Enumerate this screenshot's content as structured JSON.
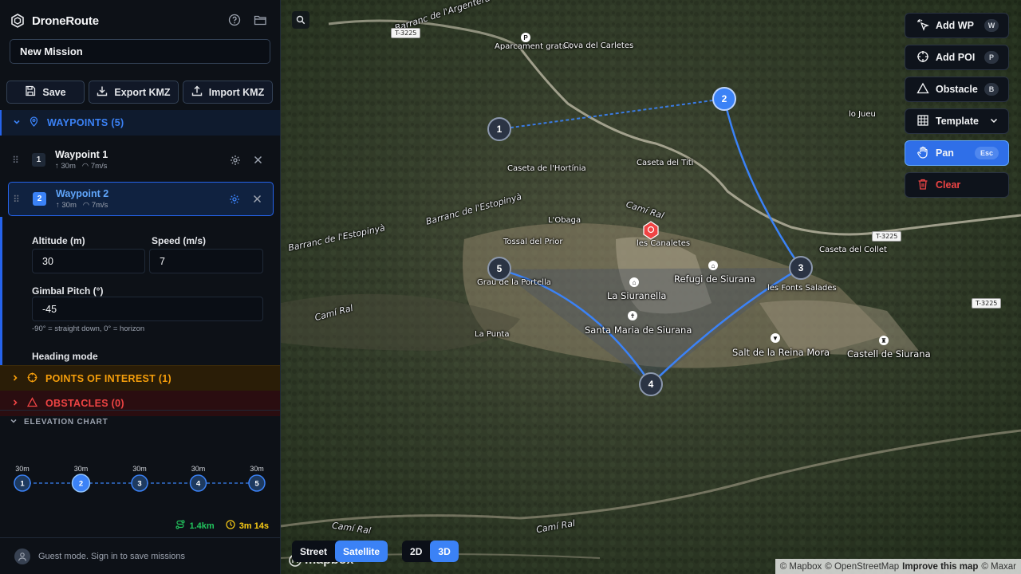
{
  "app": {
    "name": "DroneRoute"
  },
  "mission": {
    "name": "New Mission"
  },
  "actions": {
    "save": "Save",
    "export": "Export KMZ",
    "import": "Import KMZ"
  },
  "waypoints_section": {
    "title": "WAYPOINTS (5)"
  },
  "waypoints": [
    {
      "num": "1",
      "title": "Waypoint 1",
      "alt": "30m",
      "speed": "7m/s"
    },
    {
      "num": "2",
      "title": "Waypoint 2",
      "alt": "30m",
      "speed": "7m/s"
    }
  ],
  "editor": {
    "altitude_label": "Altitude (m)",
    "altitude_value": "30",
    "speed_label": "Speed (m/s)",
    "speed_value": "7",
    "gimbal_label": "Gimbal Pitch (°)",
    "gimbal_value": "-45",
    "gimbal_hint": "-90° = straight down, 0° = horizon",
    "heading_label": "Heading mode"
  },
  "poi_section": {
    "title": "POINTS OF INTEREST (1)"
  },
  "obstacles_section": {
    "title": "OBSTACLES (0)"
  },
  "elevation": {
    "title": "ELEVATION CHART",
    "points": [
      {
        "num": "1",
        "alt": "30m",
        "active": false
      },
      {
        "num": "2",
        "alt": "30m",
        "active": true
      },
      {
        "num": "3",
        "alt": "30m",
        "active": false
      },
      {
        "num": "4",
        "alt": "30m",
        "active": false
      },
      {
        "num": "5",
        "alt": "30m",
        "active": false
      }
    ]
  },
  "stats": {
    "distance": "1.4km",
    "time": "3m 14s"
  },
  "footer": {
    "text": "Guest mode. Sign in to save missions"
  },
  "tools": [
    {
      "label": "Add WP",
      "key": "W",
      "state": "normal",
      "icon": "add-waypoint-icon"
    },
    {
      "label": "Add POI",
      "key": "P",
      "state": "normal",
      "icon": "crosshair-icon"
    },
    {
      "label": "Obstacle",
      "key": "B",
      "state": "normal",
      "icon": "triangle-icon"
    },
    {
      "label": "Template",
      "key": "",
      "state": "normal",
      "icon": "grid-icon"
    },
    {
      "label": "Pan",
      "key": "Esc",
      "state": "active",
      "icon": "hand-icon"
    },
    {
      "label": "Clear",
      "key": "",
      "state": "danger",
      "icon": "trash-icon"
    }
  ],
  "view": {
    "street": "Street",
    "satellite": "Satellite",
    "d2": "2D",
    "d3": "3D"
  },
  "attribution": {
    "mapbox": "© Mapbox",
    "osm": "© OpenStreetMap",
    "improve": "Improve this map",
    "maxar": "© Maxar"
  },
  "map_pins": [
    {
      "num": "1"
    },
    {
      "num": "2"
    },
    {
      "num": "3"
    },
    {
      "num": "4"
    },
    {
      "num": "5"
    }
  ],
  "map_labels": {
    "aparcament": "Aparcament gratuït",
    "cova": "Cova del Carletes",
    "hortinia": "Caseta de l'Hortínia",
    "titi": "Caseta del Titi",
    "barranc1": "Barranc de l'Estopinyà",
    "barranc2": "Barranc de l'Estopinyà",
    "obaga": "L'Obaga",
    "tossal": "Tossal del Prior",
    "camiral1": "Camí Ral",
    "canaletes": "les Canaletes",
    "refugi": "Refugi de Siurana",
    "siuranella": "La Siuranella",
    "grau": "Grau de la Portella",
    "santa": "Santa Maria de Siurana",
    "punta": "La Punta",
    "fonts": "les Fonts Salades",
    "collet": "Caseta del Collet",
    "salt": "Salt de la Reina Mora",
    "castell": "Castell de Siurana",
    "camiral2": "Camí Ral",
    "camiral3": "Camí Ral",
    "camiral4": "Camí Ral",
    "jueu": "lo Jueu",
    "argentera": "Barranc de l'Argentera",
    "t3225a": "T-3225",
    "t3225b": "T-3225",
    "t3225c": "T-3225",
    "mapbox": "mapbox"
  }
}
